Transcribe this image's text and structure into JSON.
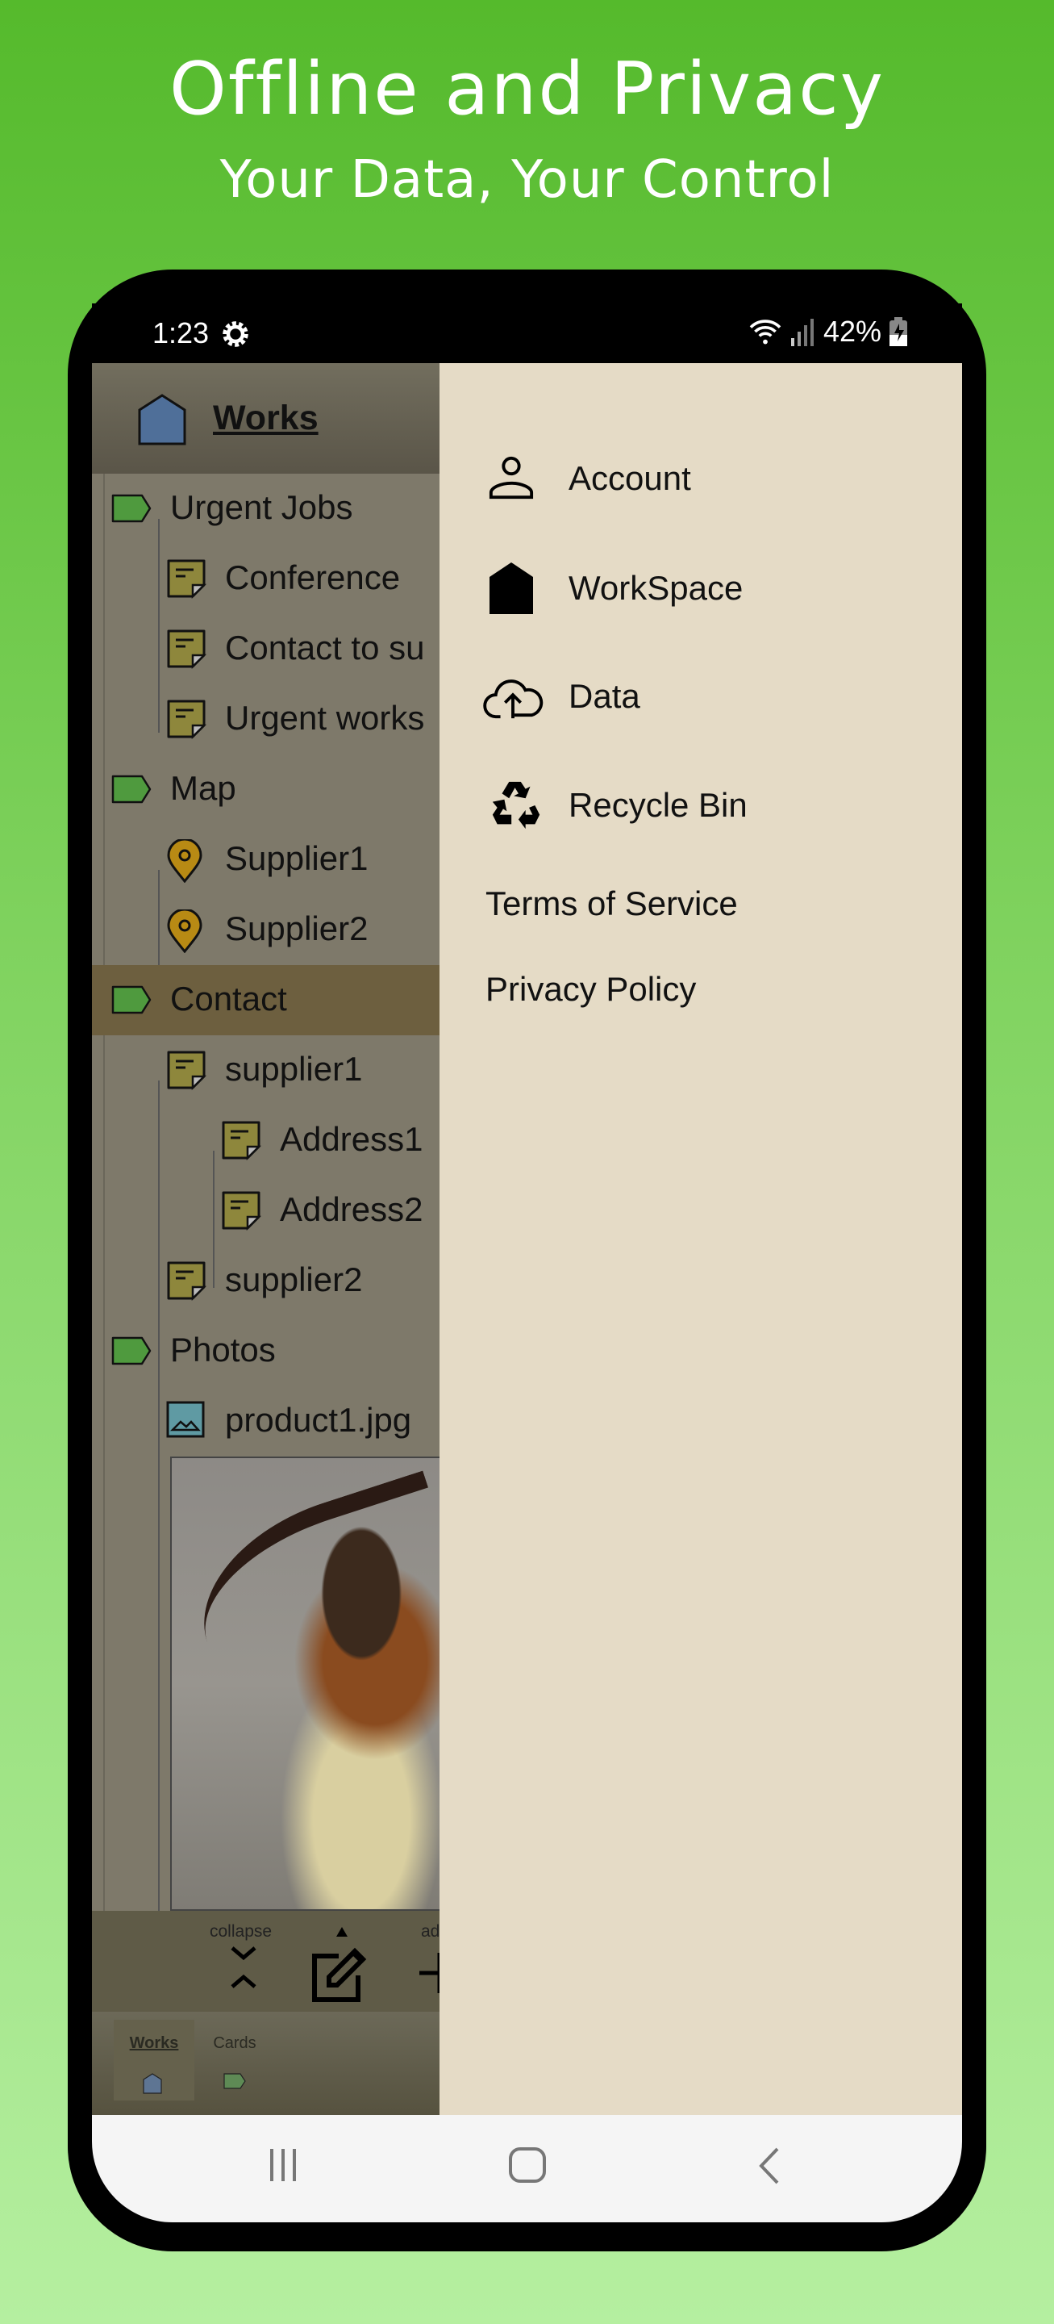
{
  "promo": {
    "title": "Offline and Privacy",
    "subtitle": "Your Data, Your Control"
  },
  "status_bar": {
    "time": "1:23",
    "battery": "42%",
    "icons": [
      "gear-icon",
      "wifi-icon",
      "signal-icon",
      "battery-charging-icon"
    ]
  },
  "header": {
    "title": "Works",
    "icon": "house-icon",
    "icon_color": "#4f6f99"
  },
  "tree": [
    {
      "label": "Urgent Jobs",
      "icon": "tag-icon",
      "level": 0
    },
    {
      "label": "Conference",
      "icon": "note-icon",
      "level": 1
    },
    {
      "label": "Contact to su",
      "icon": "note-icon",
      "level": 1
    },
    {
      "label": "Urgent works",
      "icon": "note-icon",
      "level": 1
    },
    {
      "label": "Map",
      "icon": "tag-icon",
      "level": 0
    },
    {
      "label": "Supplier1",
      "icon": "map-pin-icon",
      "level": 1
    },
    {
      "label": "Supplier2",
      "icon": "map-pin-icon",
      "level": 1
    },
    {
      "label": "Contact",
      "icon": "tag-icon",
      "level": 0,
      "selected": true
    },
    {
      "label": "supplier1",
      "icon": "note-icon",
      "level": 1
    },
    {
      "label": "Address1",
      "icon": "note-icon",
      "level": 2
    },
    {
      "label": "Address2",
      "icon": "note-icon",
      "level": 2
    },
    {
      "label": "supplier2",
      "icon": "note-icon",
      "level": 1
    },
    {
      "label": "Photos",
      "icon": "tag-icon",
      "level": 0
    },
    {
      "label": "product1.jpg",
      "icon": "image-icon",
      "level": 1
    }
  ],
  "toolbar": {
    "collapse_label": "collapse",
    "add_label": "add"
  },
  "bottom_tabs": [
    {
      "label": "Works",
      "active": true
    },
    {
      "label": "Cards",
      "active": false
    }
  ],
  "drawer": {
    "items": [
      {
        "label": "Account",
        "icon": "person-icon"
      },
      {
        "label": "WorkSpace",
        "icon": "house-icon"
      },
      {
        "label": "Data",
        "icon": "cloud-upload-icon"
      },
      {
        "label": "Recycle Bin",
        "icon": "recycle-icon"
      },
      {
        "label": "Terms of Service"
      },
      {
        "label": "Privacy Policy"
      }
    ]
  },
  "colors": {
    "tag": "#4f9a3e",
    "note": "#8e873c",
    "pin": "#b88a14",
    "drawer_bg": "#e5dbc6",
    "promo_bg": "#55ba2c"
  }
}
